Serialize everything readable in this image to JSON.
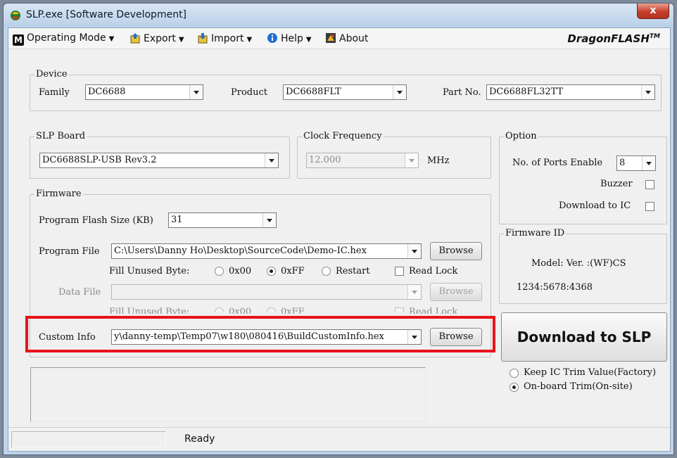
{
  "window": {
    "title": "SLP.exe [Software Development]",
    "close_label": "x"
  },
  "menu": {
    "operating_mode": "Operating Mode",
    "export": "Export",
    "import": "Import",
    "help": "Help",
    "about": "About",
    "brand": "DragonFLASH",
    "brand_sup": "TM"
  },
  "device": {
    "title": "Device",
    "family_label": "Family",
    "family_value": "DC6688",
    "product_label": "Product",
    "product_value": "DC6688FLT",
    "partno_label": "Part No.",
    "partno_value": "DC6688FL32TT"
  },
  "slp_board": {
    "title": "SLP Board",
    "value": "DC6688SLP-USB Rev3.2"
  },
  "clock": {
    "title": "Clock Frequency",
    "value": "12.000",
    "unit": "MHz"
  },
  "option": {
    "title": "Option",
    "ports_label": "No. of Ports Enable",
    "ports_value": "8",
    "buzzer_label": "Buzzer",
    "download_ic_label": "Download to IC"
  },
  "firmware_id": {
    "title": "Firmware ID",
    "model_line": "Model:  Ver. :(WF)CS",
    "id_line": "1234:5678:4368"
  },
  "firmware": {
    "title": "Firmware",
    "flash_size_label": "Program Flash Size (KB)",
    "flash_size_value": "31",
    "program_file_label": "Program File",
    "program_file_value": "C:\\Users\\Danny Ho\\Desktop\\SourceCode\\Demo-IC.hex",
    "browse_label": "Browse",
    "fill_unused_label": "Fill Unused Byte:",
    "opt_0x00": "0x00",
    "opt_0xff": "0xFF",
    "opt_restart": "Restart",
    "read_lock_label": "Read Lock",
    "data_file_label": "Data File",
    "data_file_value": "",
    "data_browse_label": "Browse",
    "data_fill_unused_label": "Fill Unused Byte:",
    "data_opt_0x00": "0x00",
    "data_opt_0xff": "0xFF",
    "data_read_lock_label": "Read Lock"
  },
  "custom_info": {
    "label": "Custom Info",
    "value": "y\\danny-temp\\Temp07\\w180\\080416\\BuildCustomInfo.hex",
    "browse_label": "Browse"
  },
  "download_button": "Download to SLP",
  "trim": {
    "keep_label": "Keep IC Trim Value(Factory)",
    "onboard_label": "On-board Trim(On-site)"
  },
  "status": {
    "text": "Ready"
  },
  "colors": {
    "highlight": "#e8131a",
    "title_bar": "#bfd3ea"
  }
}
